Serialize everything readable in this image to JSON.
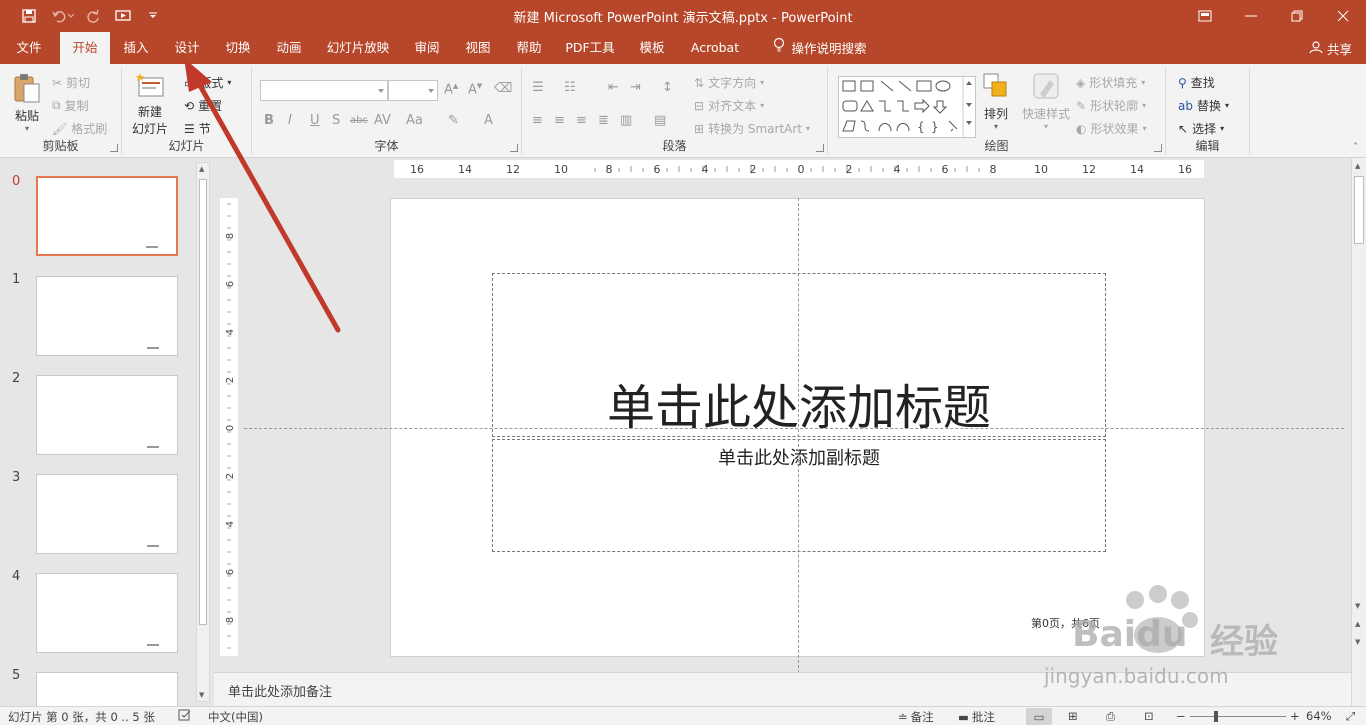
{
  "titlebar": {
    "title": "新建 Microsoft PowerPoint 演示文稿.pptx  -  PowerPoint",
    "color": "#b7472a"
  },
  "tabs": {
    "items": [
      {
        "label": "文件"
      },
      {
        "label": "开始",
        "active": true
      },
      {
        "label": "插入"
      },
      {
        "label": "设计"
      },
      {
        "label": "切换"
      },
      {
        "label": "动画"
      },
      {
        "label": "幻灯片放映"
      },
      {
        "label": "审阅"
      },
      {
        "label": "视图"
      },
      {
        "label": "帮助"
      },
      {
        "label": "PDF工具"
      },
      {
        "label": "模板"
      },
      {
        "label": "Acrobat"
      }
    ],
    "tell_me": "操作说明搜索",
    "share": "共享"
  },
  "ribbon": {
    "clipboard": {
      "label": "剪贴板",
      "paste": "粘贴",
      "cut": "剪切",
      "copy": "复制",
      "format_painter": "格式刷"
    },
    "slides": {
      "label": "幻灯片",
      "new_slide_1": "新建",
      "new_slide_2": "幻灯片",
      "layout": "版式",
      "reset": "重置",
      "section": "节"
    },
    "font": {
      "label": "字体",
      "bold": "B",
      "italic": "I",
      "underline": "U",
      "shadow": "S",
      "strike": "abc",
      "spacing": "AV",
      "case": "Aa",
      "color": "A"
    },
    "paragraph": {
      "label": "段落",
      "text_direction": "文字方向",
      "align_text": "对齐文本",
      "smartart": "转换为 SmartArt"
    },
    "drawing": {
      "label": "绘图",
      "arrange": "排列",
      "quick_styles": "快速样式",
      "shape_fill": "形状填充",
      "shape_outline": "形状轮廓",
      "shape_effects": "形状效果"
    },
    "editing": {
      "label": "编辑",
      "find": "查找",
      "replace": "替换",
      "select": "选择"
    }
  },
  "thumbnails": {
    "numbers": [
      "0",
      "1",
      "2",
      "3",
      "4",
      "5"
    ],
    "selected_color": "#e3794f"
  },
  "rulers": {
    "h_labels": [
      "16",
      "14",
      "12",
      "10",
      "8",
      "6",
      "4",
      "2",
      "0",
      "2",
      "4",
      "6",
      "8",
      "10",
      "12",
      "14",
      "16"
    ],
    "v_labels": [
      "8",
      "6",
      "4",
      "2",
      "0",
      "2",
      "4",
      "6",
      "8"
    ]
  },
  "slide": {
    "title_placeholder": "单击此处添加标题",
    "subtitle_placeholder": "单击此处添加副标题",
    "footer": "第0页，共6页"
  },
  "notes": {
    "placeholder": "单击此处添加备注"
  },
  "status": {
    "slide_info": "幻灯片 第 0 张，共 0 .. 5 张",
    "language": "中文(中国)",
    "notes": "备注",
    "comments": "批注",
    "zoom": "64%"
  },
  "watermark": {
    "text1": "Baidu",
    "text2": "经验",
    "url": "jingyan.baidu.com"
  },
  "annotation": {
    "arrow_color": "#c0392b"
  }
}
